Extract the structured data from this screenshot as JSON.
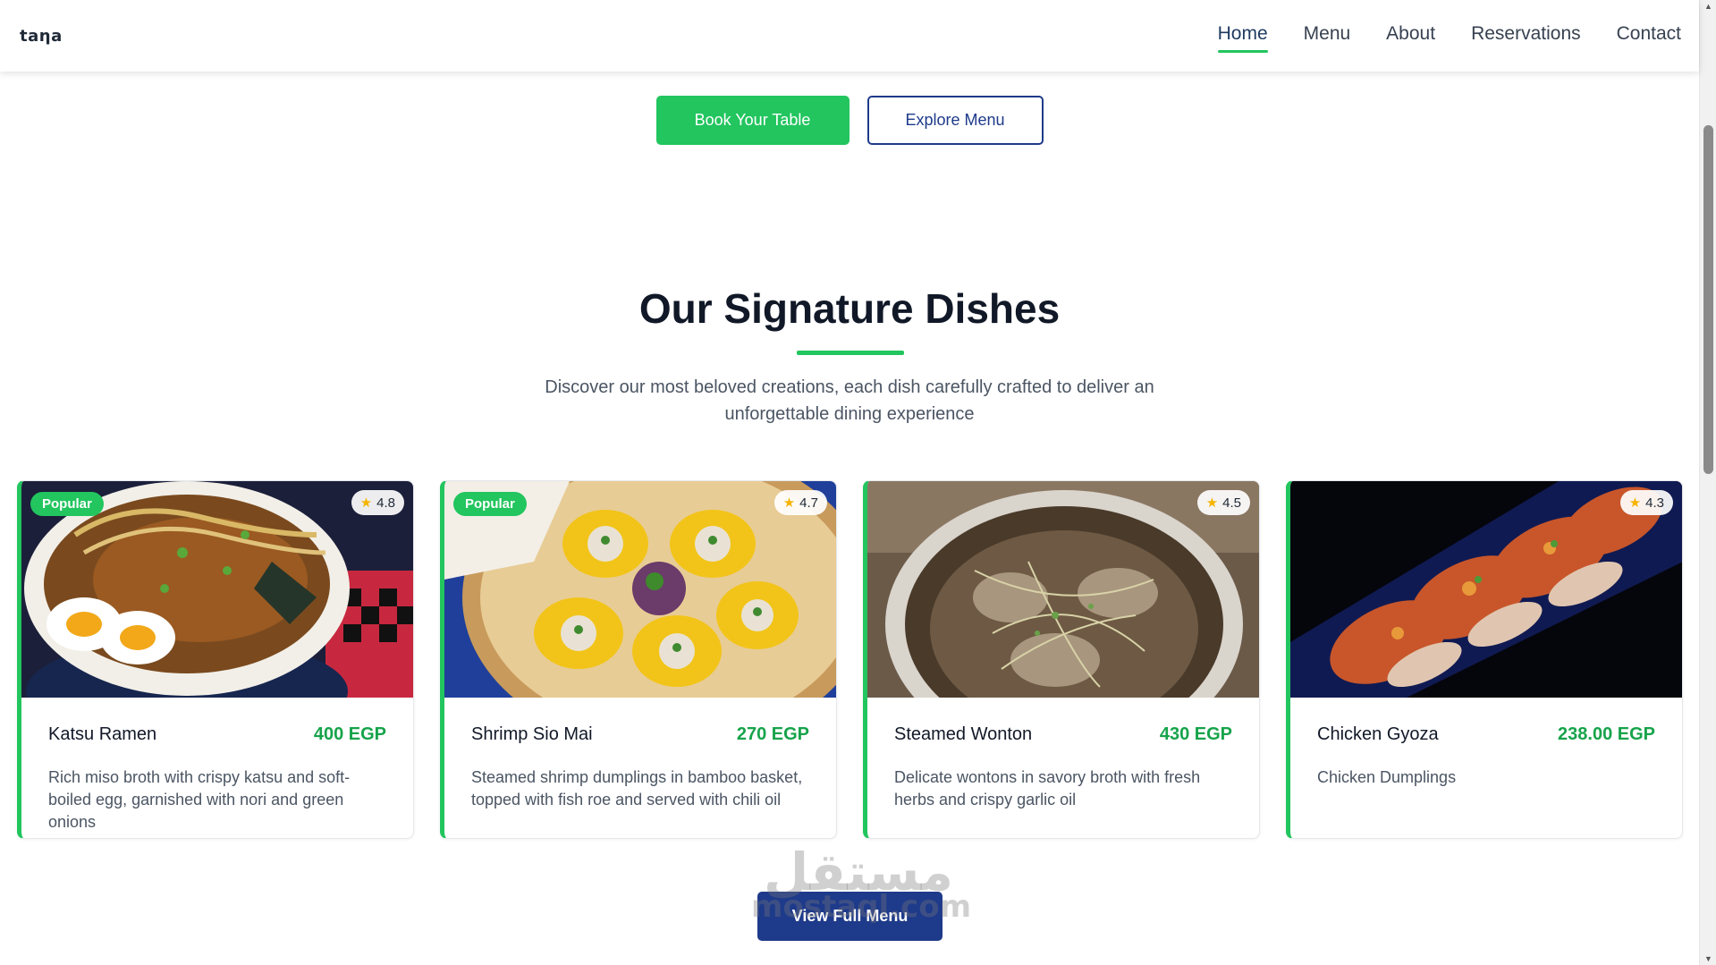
{
  "header": {
    "logo": "taƞa",
    "nav": [
      {
        "label": "Home",
        "active": true
      },
      {
        "label": "Menu",
        "active": false
      },
      {
        "label": "About",
        "active": false
      },
      {
        "label": "Reservations",
        "active": false
      },
      {
        "label": "Contact",
        "active": false
      }
    ]
  },
  "hero": {
    "book_label": "Book Your Table",
    "explore_label": "Explore Menu"
  },
  "section": {
    "title": "Our Signature Dishes",
    "subtitle": "Discover our most beloved creations, each dish carefully crafted to deliver an unforgettable dining experience"
  },
  "dishes": [
    {
      "name": "Katsu Ramen",
      "price": "400 EGP",
      "rating": "4.8",
      "badge": "Popular",
      "description": "Rich miso broth with crispy katsu and soft-boiled egg, garnished with nori and green onions"
    },
    {
      "name": "Shrimp Sio Mai",
      "price": "270 EGP",
      "rating": "4.7",
      "badge": "Popular",
      "description": "Steamed shrimp dumplings in bamboo basket, topped with fish roe and served with chili oil"
    },
    {
      "name": "Steamed Wonton",
      "price": "430 EGP",
      "rating": "4.5",
      "badge": "",
      "description": "Delicate wontons in savory broth with fresh herbs and crispy garlic oil"
    },
    {
      "name": "Chicken Gyoza",
      "price": "238.00 EGP",
      "rating": "4.3",
      "badge": "",
      "description": "Chicken Dumplings"
    }
  ],
  "footer_cta": {
    "view_menu_label": "View Full Menu"
  },
  "watermark": {
    "arabic": "مستقل",
    "latin": "mostaql.com"
  },
  "colors": {
    "accent": "#22c55e",
    "brand_blue": "#1e3a8a",
    "price": "#16a34a"
  },
  "icons": {
    "rating": "star-icon"
  }
}
